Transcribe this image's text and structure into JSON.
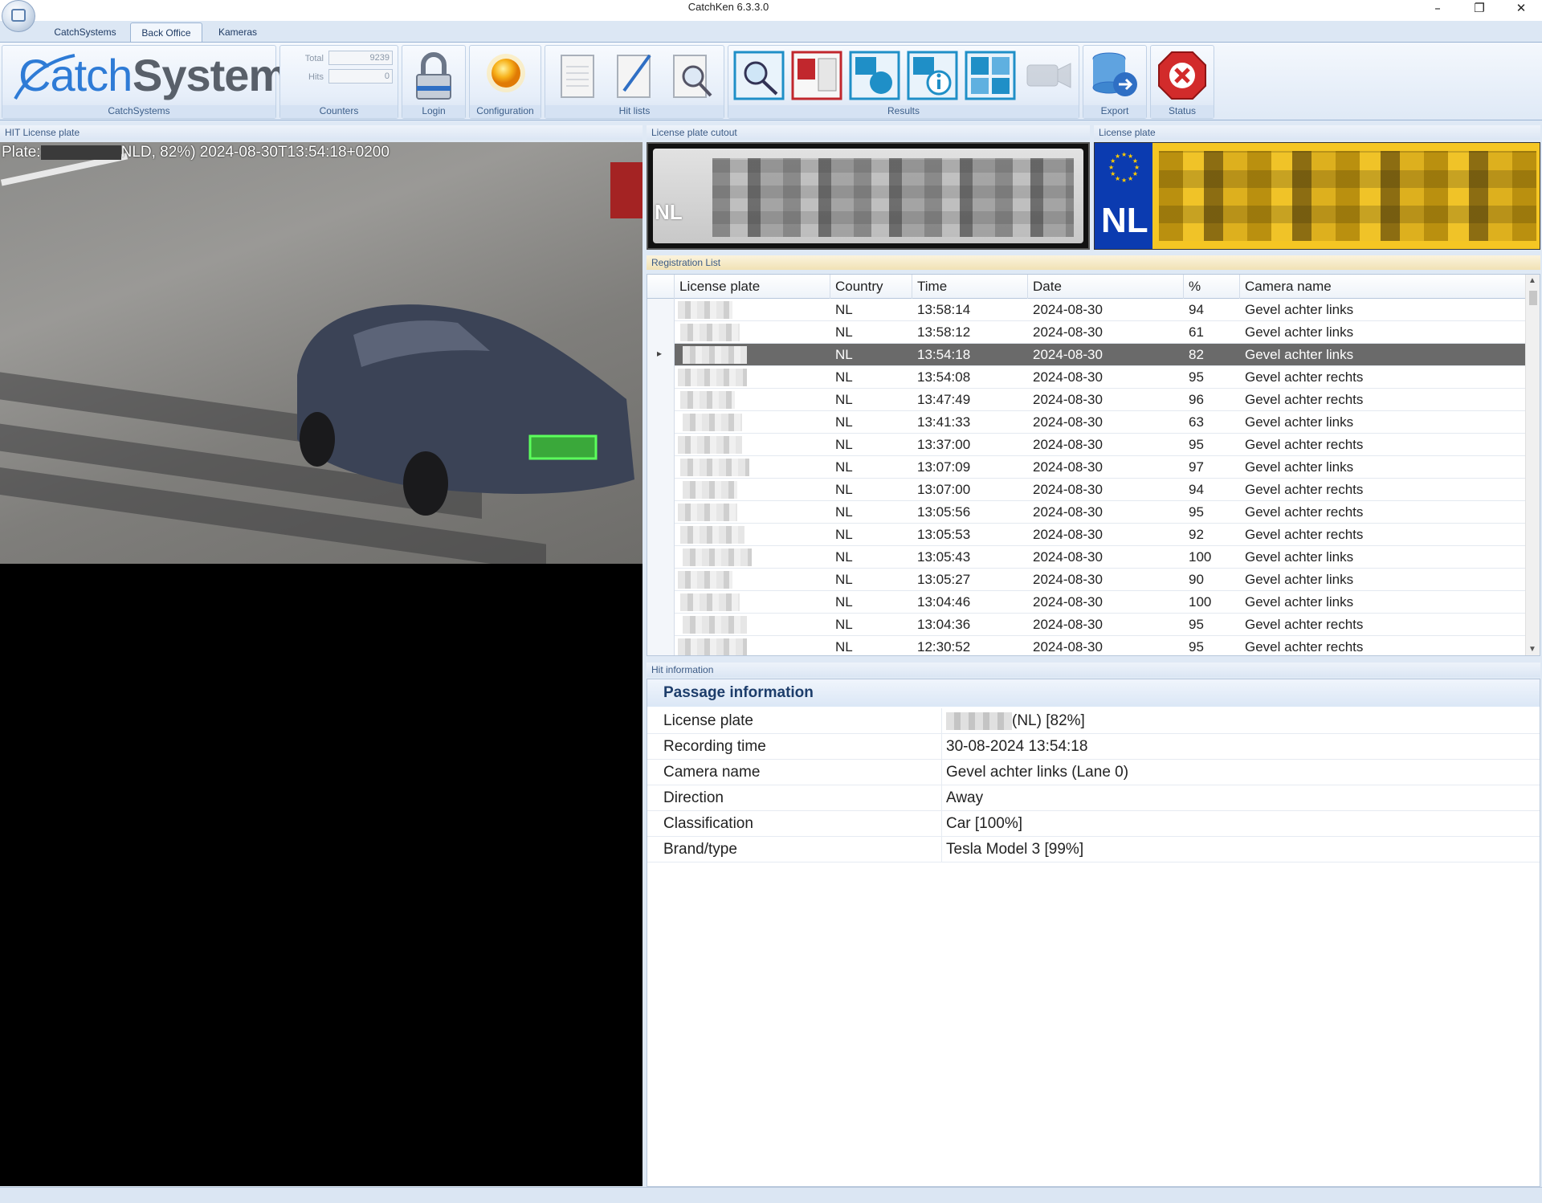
{
  "window": {
    "title": "CatchKen 6.3.3.0",
    "minimize": "–",
    "restore": "❐",
    "close": "✕"
  },
  "ribbon": {
    "tabs": [
      {
        "label": "CatchSystems"
      },
      {
        "label": "Back Office",
        "active": true
      },
      {
        "label": "Kameras"
      }
    ],
    "groups": {
      "catchsystems": "CatchSystems",
      "counters": "Counters",
      "login": "Login",
      "configuration": "Configuration",
      "hit_lists": "Hit lists",
      "results": "Results",
      "export": "Export",
      "status": "Status"
    },
    "logo": {
      "part1": "Catch",
      "part2": "Systems"
    },
    "counters": {
      "total_label": "Total",
      "total_value": "9239",
      "hits_label": "Hits",
      "hits_value": "0"
    },
    "icons": [
      "lock-icon",
      "sun-icon",
      "notepad-icon",
      "pencil-notepad-icon",
      "magnifier-notepad-icon",
      "search-results-icon",
      "red-layout-icon",
      "disc-layout-icon",
      "info-layout-icon",
      "grid-layout-icon",
      "video-camera-icon",
      "database-export-icon",
      "red-x-status-icon"
    ]
  },
  "panels": {
    "hit_license_plate": "HIT License plate",
    "cutout": "License plate cutout",
    "license_plate": "License plate",
    "registration_list": "Registration List",
    "hit_information": "Hit information"
  },
  "camera": {
    "overlay_prefix": "Plate:",
    "overlay_suffix": "NLD, 82%) 2024-08-30T13:54:18+0200"
  },
  "plate": {
    "country": "NL",
    "colors": {
      "plate": "#f5c623",
      "eu_band": "#0b3bb0"
    }
  },
  "grid": {
    "columns": [
      "License plate",
      "Country",
      "Time",
      "Date",
      "%",
      "Camera name"
    ],
    "rows": [
      {
        "country": "NL",
        "time": "13:58:14",
        "date": "2024-08-30",
        "pct": "94",
        "camera": "Gevel achter links"
      },
      {
        "country": "NL",
        "time": "13:58:12",
        "date": "2024-08-30",
        "pct": "61",
        "camera": "Gevel achter links"
      },
      {
        "country": "NL",
        "time": "13:54:18",
        "date": "2024-08-30",
        "pct": "82",
        "camera": "Gevel achter links",
        "selected": true
      },
      {
        "country": "NL",
        "time": "13:54:08",
        "date": "2024-08-30",
        "pct": "95",
        "camera": "Gevel achter rechts"
      },
      {
        "country": "NL",
        "time": "13:47:49",
        "date": "2024-08-30",
        "pct": "96",
        "camera": "Gevel achter rechts"
      },
      {
        "country": "NL",
        "time": "13:41:33",
        "date": "2024-08-30",
        "pct": "63",
        "camera": "Gevel achter links"
      },
      {
        "country": "NL",
        "time": "13:37:00",
        "date": "2024-08-30",
        "pct": "95",
        "camera": "Gevel achter rechts"
      },
      {
        "country": "NL",
        "time": "13:07:09",
        "date": "2024-08-30",
        "pct": "97",
        "camera": "Gevel achter links"
      },
      {
        "country": "NL",
        "time": "13:07:00",
        "date": "2024-08-30",
        "pct": "94",
        "camera": "Gevel achter rechts"
      },
      {
        "country": "NL",
        "time": "13:05:56",
        "date": "2024-08-30",
        "pct": "95",
        "camera": "Gevel achter rechts"
      },
      {
        "country": "NL",
        "time": "13:05:53",
        "date": "2024-08-30",
        "pct": "92",
        "camera": "Gevel achter rechts"
      },
      {
        "country": "NL",
        "time": "13:05:43",
        "date": "2024-08-30",
        "pct": "100",
        "camera": "Gevel achter links"
      },
      {
        "country": "NL",
        "time": "13:05:27",
        "date": "2024-08-30",
        "pct": "90",
        "camera": "Gevel achter links"
      },
      {
        "country": "NL",
        "time": "13:04:46",
        "date": "2024-08-30",
        "pct": "100",
        "camera": "Gevel achter links"
      },
      {
        "country": "NL",
        "time": "13:04:36",
        "date": "2024-08-30",
        "pct": "95",
        "camera": "Gevel achter rechts"
      },
      {
        "country": "NL",
        "time": "12:30:52",
        "date": "2024-08-30",
        "pct": "95",
        "camera": "Gevel achter rechts"
      }
    ]
  },
  "passage": {
    "title": "Passage information",
    "rows": [
      {
        "key": "License plate",
        "value": "(NL) [82%]"
      },
      {
        "key": "Recording time",
        "value": "30-08-2024 13:54:18"
      },
      {
        "key": "Camera name",
        "value": "Gevel achter links (Lane 0)"
      },
      {
        "key": "Direction",
        "value": "Away"
      },
      {
        "key": "Classification",
        "value": "Car [100%]"
      },
      {
        "key": "Brand/type",
        "value": "Tesla Model 3 [99%]"
      }
    ]
  }
}
